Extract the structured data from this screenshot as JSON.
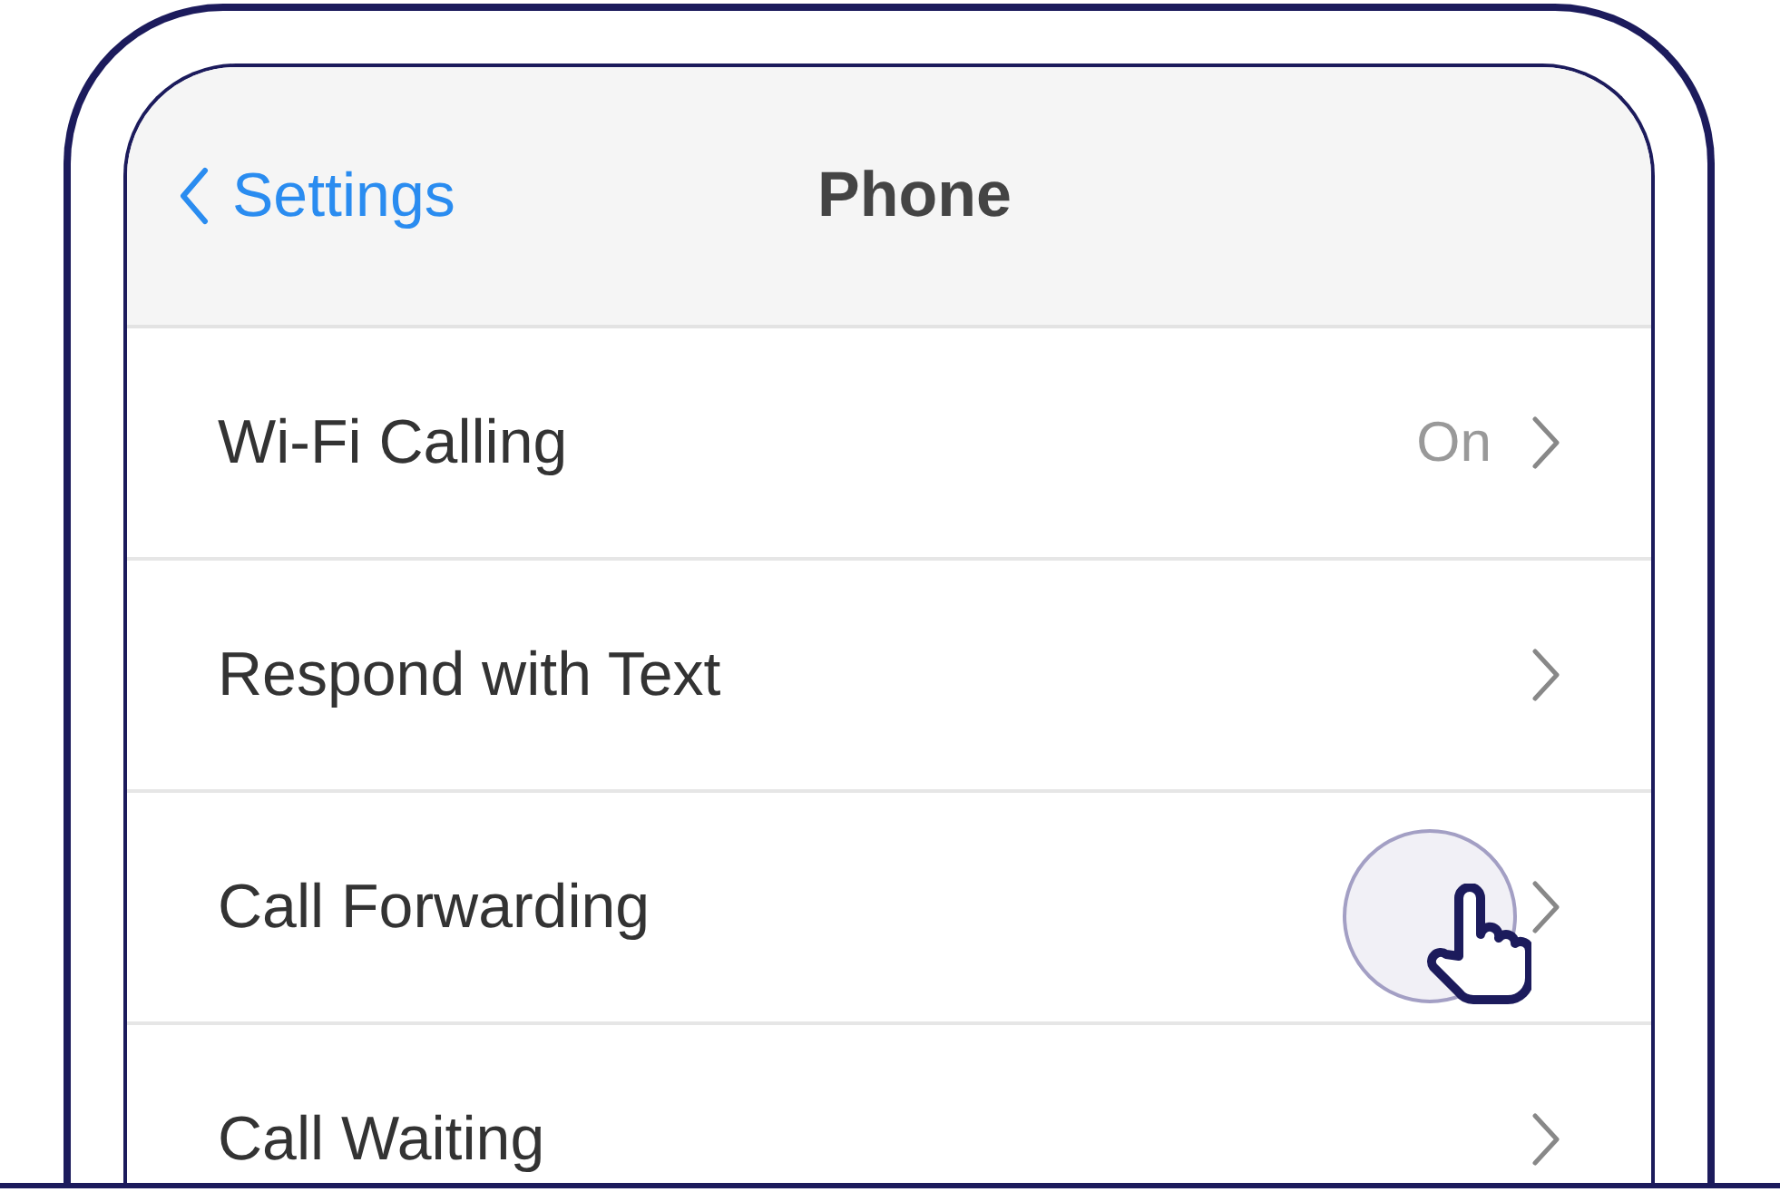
{
  "nav_bar": {
    "back_label": "Settings",
    "title": "Phone"
  },
  "rows": [
    {
      "label": "Wi-Fi Calling",
      "value": "On",
      "touched": false
    },
    {
      "label": "Respond with Text",
      "touched": false
    },
    {
      "label": "Call Forwarding",
      "touched": true
    },
    {
      "label": "Call Waiting",
      "touched": false
    }
  ]
}
